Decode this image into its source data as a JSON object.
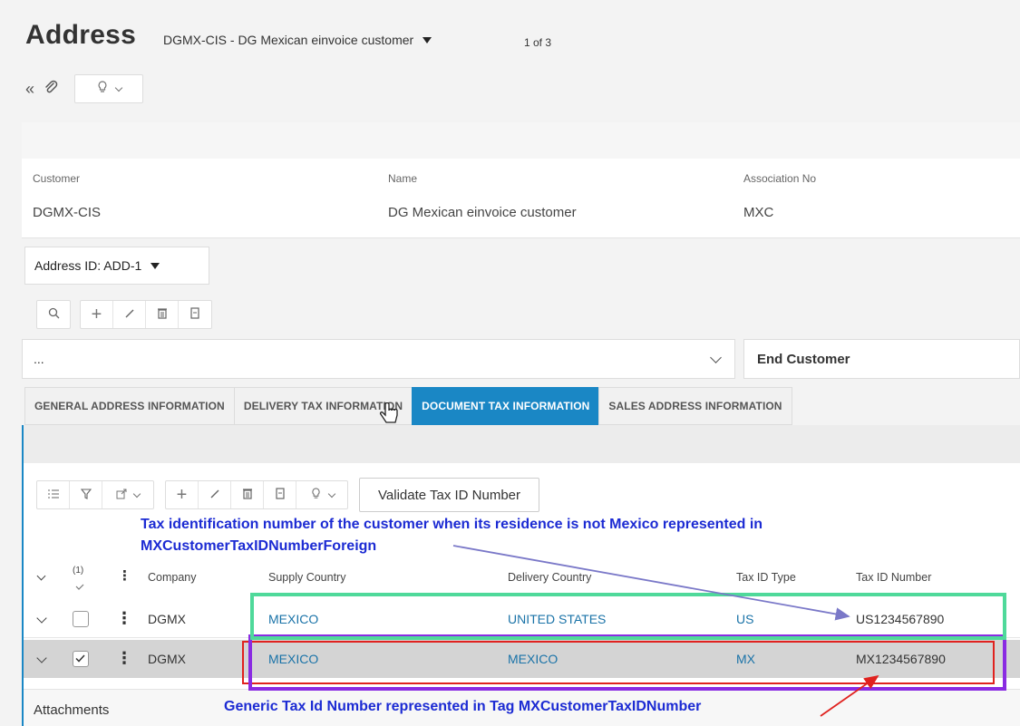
{
  "header": {
    "title": "Address",
    "record": "DGMX-CIS - DG Mexican einvoice customer",
    "record_count": "1 of 3"
  },
  "fields": {
    "customer_label": "Customer",
    "customer_value": "DGMX-CIS",
    "name_label": "Name",
    "name_value": "DG Mexican einvoice customer",
    "assoc_label": "Association No",
    "assoc_value": "MXC"
  },
  "address_selector": "Address ID: ADD-1",
  "dots_select": "...",
  "end_customer": "End Customer",
  "tabs": [
    {
      "label": "GENERAL ADDRESS INFORMATION",
      "active": false
    },
    {
      "label": "DELIVERY TAX INFORMATION",
      "active": false
    },
    {
      "label": "DOCUMENT TAX INFORMATION",
      "active": true
    },
    {
      "label": "SALES ADDRESS INFORMATION",
      "active": false
    }
  ],
  "validate_button": "Validate Tax ID Number",
  "annotations": {
    "foreign_line1": "Tax identification number of the customer when its residence is not Mexico represented in",
    "foreign_line2": "MXCustomerTaxIDNumberForeign",
    "generic": "Generic Tax Id Number represented in Tag MXCustomerTaxIDNumber"
  },
  "table": {
    "selected_count": "(1)",
    "columns": [
      "Company",
      "Supply Country",
      "Delivery Country",
      "Tax ID Type",
      "Tax ID Number"
    ],
    "rows": [
      {
        "company": "DGMX",
        "supply": "MEXICO",
        "delivery": "UNITED STATES",
        "type": "US",
        "number": "US1234567890",
        "selected": false
      },
      {
        "company": "DGMX",
        "supply": "MEXICO",
        "delivery": "MEXICO",
        "type": "MX",
        "number": "MX1234567890",
        "selected": true
      }
    ]
  },
  "attachments": "Attachments",
  "colors": {
    "accent": "#1a87c5",
    "annotation_blue": "#1c2bd3",
    "highlight_green": "#4fd99a",
    "highlight_red": "#e0221f",
    "highlight_purple": "#8a2be2"
  },
  "icons": [
    "double-chevron-left-icon",
    "paperclip-icon",
    "lightbulb-icon",
    "search-icon",
    "plus-icon",
    "pencil-icon",
    "trash-icon",
    "duplicate-icon",
    "list-icon",
    "filter-icon",
    "export-icon"
  ]
}
